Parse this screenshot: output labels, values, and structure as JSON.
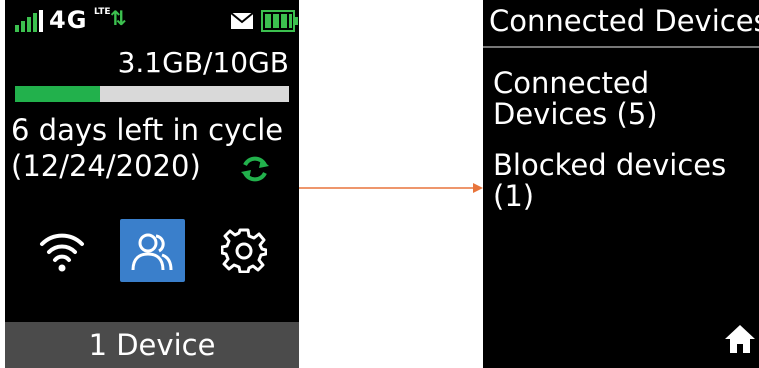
{
  "left_screen": {
    "status": {
      "network_label": "4G",
      "network_sub": "LTE",
      "signal_icon": "signal-bars-icon",
      "data_arrows": "⇅",
      "mail_icon": "mail-icon",
      "battery_icon": "battery-full-icon"
    },
    "data_usage": {
      "label": "3.1GB/10GB",
      "fraction_used": 0.31
    },
    "cycle": {
      "days_left_text": "6 days left in cycle",
      "date_text": "(12/24/2020)"
    },
    "icons": [
      "wifi-icon",
      "users-icon",
      "gear-icon",
      "refresh-icon"
    ],
    "footer_label": "1 Device"
  },
  "right_screen": {
    "title": "Connected Devices",
    "items": [
      {
        "label": "Connected\nDevices (5)"
      },
      {
        "label": "Blocked devices\n(1)"
      }
    ],
    "home_icon": "home-icon"
  },
  "colors": {
    "screen_bg": "#000000",
    "accent_green": "#22b14c",
    "icon_green": "#3cc04f",
    "selected_blue": "#3a7fcb",
    "footer_gray": "#4b4b4b",
    "arrow_orange": "#e8743b"
  }
}
